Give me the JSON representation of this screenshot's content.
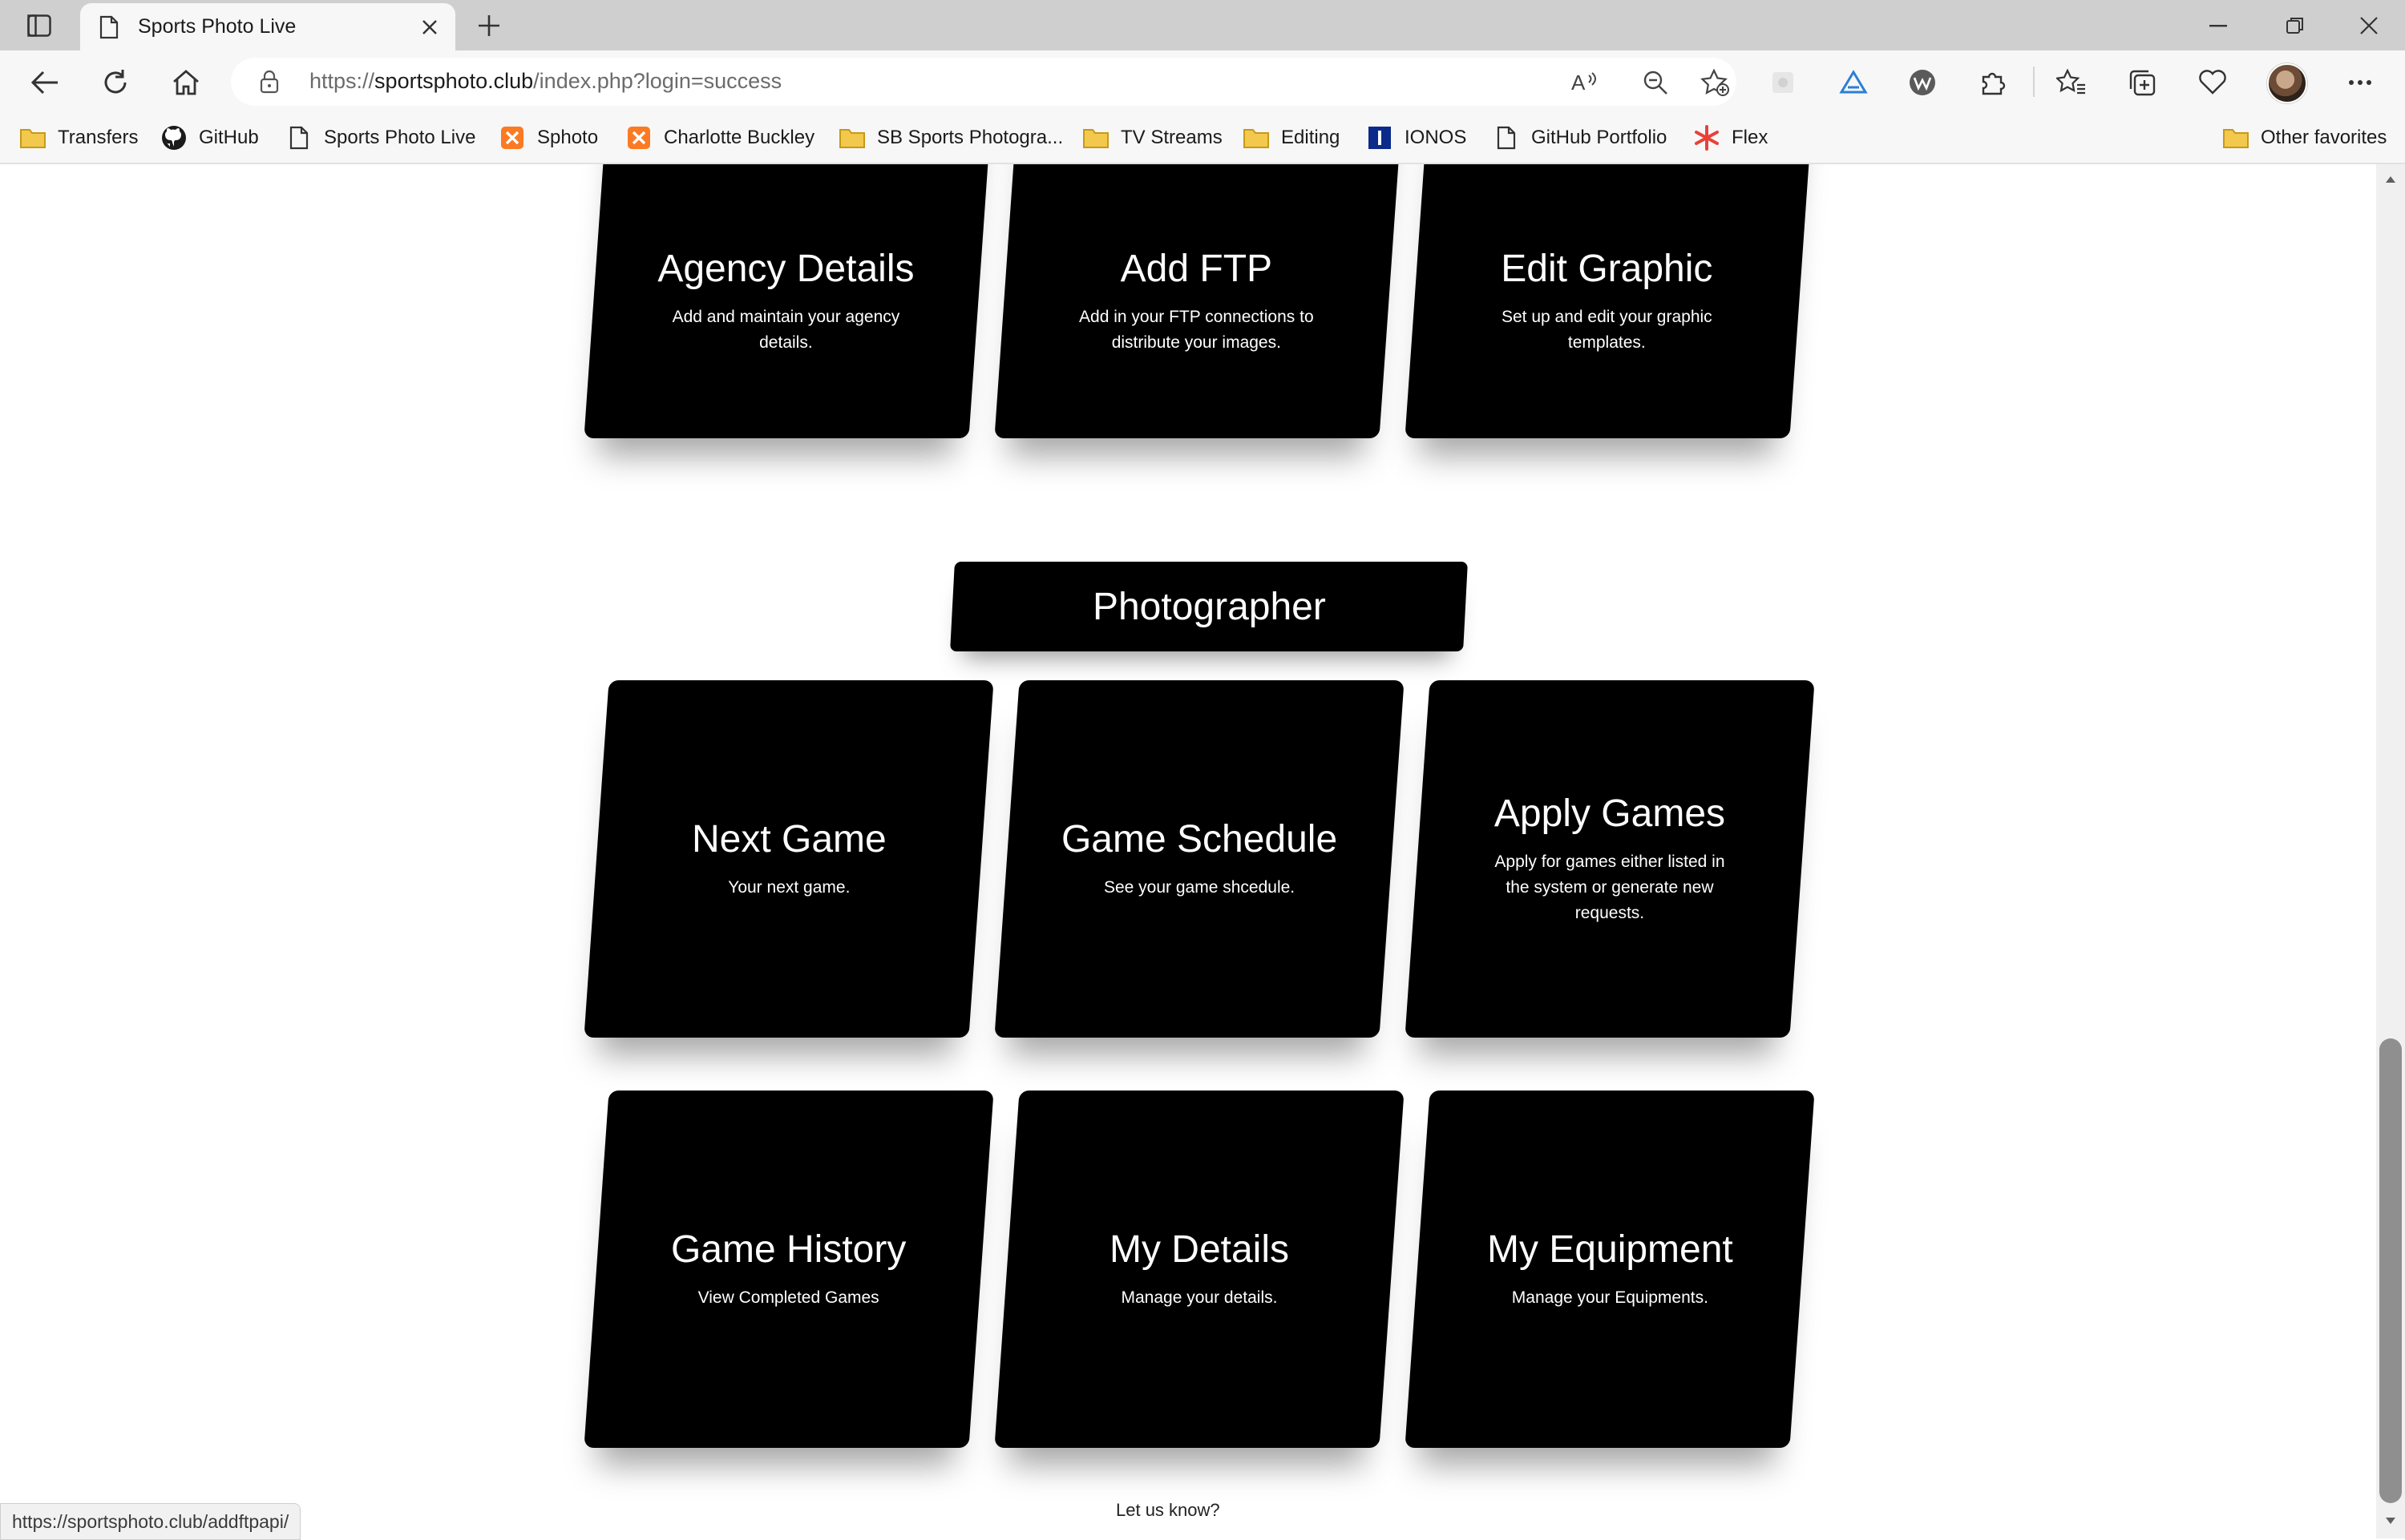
{
  "browser": {
    "tab_title": "Sports Photo Live",
    "url_prefix": "https://",
    "url_host": "sportsphoto.club",
    "url_path": "/index.php?login=success",
    "status_url": "https://sportsphoto.club/addftpapi/"
  },
  "favorites": [
    {
      "label": "Transfers",
      "icon": "folder-icon"
    },
    {
      "label": "GitHub",
      "icon": "github-icon"
    },
    {
      "label": "Sports Photo Live",
      "icon": "page-icon"
    },
    {
      "label": "Sphoto",
      "icon": "xampp-icon"
    },
    {
      "label": "Charlotte Buckley",
      "icon": "xampp-icon"
    },
    {
      "label": "SB Sports Photogra...",
      "icon": "folder-icon"
    },
    {
      "label": "TV Streams",
      "icon": "folder-icon"
    },
    {
      "label": "Editing",
      "icon": "folder-icon"
    },
    {
      "label": "IONOS",
      "icon": "ionos-icon"
    },
    {
      "label": "GitHub Portfolio",
      "icon": "page-icon"
    },
    {
      "label": "Flex",
      "icon": "flex-icon"
    }
  ],
  "other_favorites": "Other favorites",
  "agency_cards": [
    {
      "title": "Agency Details",
      "desc": "Add and maintain your agency details."
    },
    {
      "title": "Add FTP",
      "desc": "Add in your FTP connections to distribute your images."
    },
    {
      "title": "Edit Graphic",
      "desc": "Set up and edit your graphic templates."
    }
  ],
  "section_title": "Photographer",
  "photographer_cards": [
    {
      "title": "Next Game",
      "desc": "Your next game."
    },
    {
      "title": "Game Schedule",
      "desc": "See your game shcedule."
    },
    {
      "title": "Apply Games",
      "desc": "Apply for games either listed in the system or generate new requests."
    },
    {
      "title": "Game History",
      "desc": "View Completed Games"
    },
    {
      "title": "My Details",
      "desc": "Manage your details."
    },
    {
      "title": "My Equipment",
      "desc": "Manage your Equipments."
    }
  ],
  "footer_text": "Let us know?"
}
